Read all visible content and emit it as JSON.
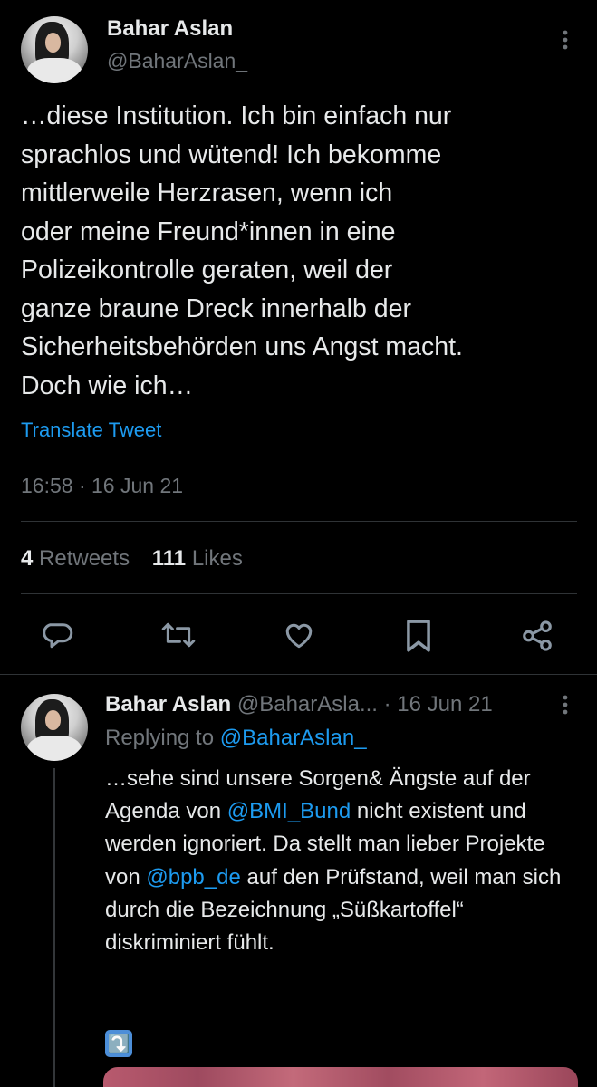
{
  "main_tweet": {
    "author_name": "Bahar Aslan",
    "author_handle": "@BaharAslan_",
    "text": "…diese Institution. Ich bin einfach nur\nsprachlos und wütend! Ich bekomme\nmittlerweile Herzrasen, wenn ich\noder meine Freund*innen in eine\nPolizeikontrolle geraten, weil der\nganze braune Dreck innerhalb der\nSicherheitsbehörden uns Angst macht.\nDoch wie ich…",
    "translate_label": "Translate Tweet",
    "timestamp": "16:58 · 16 Jun 21",
    "retweets_count": "4",
    "retweets_label": "Retweets",
    "likes_count": "111",
    "likes_label": "Likes"
  },
  "actions": {
    "reply_icon": "reply-icon",
    "retweet_icon": "retweet-icon",
    "like_icon": "heart-icon",
    "bookmark_icon": "bookmark-icon",
    "share_icon": "share-icon"
  },
  "reply_tweet": {
    "author_name": "Bahar Aslan",
    "author_handle": "@BaharAsla...",
    "date": "· 16 Jun 21",
    "replying_prefix": "Replying to",
    "replying_handle": "@BaharAslan_",
    "text_1": "…sehe sind unsere Sorgen& Ängste auf der Agenda von ",
    "mention_1": "@BMI_Bund",
    "text_2": " nicht existent und werden ignoriert. Da stellt man lieber Projekte von ",
    "mention_2": "@bpb_de",
    "text_3": " auf den Prüfstand, weil man sich durch die Bezeichnung „Süßkartoffel“ diskriminiert fühlt.",
    "emoji": "⤵️"
  },
  "colors": {
    "background": "#000000",
    "text": "#e7e9ea",
    "secondary": "#71767b",
    "link": "#1d9bf0",
    "divider": "#2f3336"
  }
}
